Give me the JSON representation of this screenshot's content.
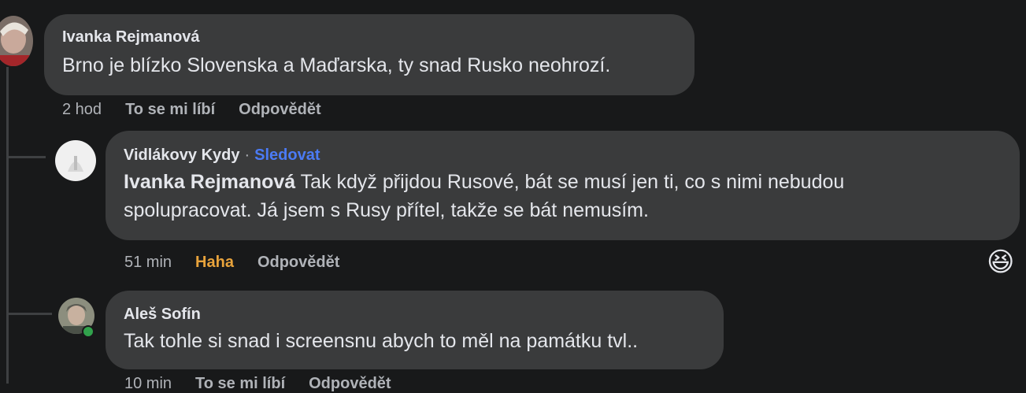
{
  "comments": [
    {
      "author": "Ivanka Rejmanová",
      "text": "Brno je blízko Slovenska a Maďarska, ty snad Rusko neohrozí.",
      "time": "2 hod",
      "like": "To se mi líbí",
      "reply": "Odpovědět"
    },
    {
      "author": "Vidlákovy Kydy",
      "follow": "Sledovat",
      "mention": "Ivanka Rejmanová",
      "text_line1": " Tak když přijdou Rusové, bát se musí jen ti, co s nimi nebudou",
      "text_line2": "spolupracovat. Já jsem s Rusy přítel, takže se bát nemusím.",
      "time": "51 min",
      "reaction_label": "Haha",
      "reply": "Odpovědět",
      "reaction_emoji": "😆"
    },
    {
      "author": "Aleš Sofín",
      "text": "Tak tohle si snad i screensnu abych to měl na památku tvl..",
      "time": "10 min",
      "like": "To se mi líbí",
      "reply": "Odpovědět"
    }
  ],
  "colors": {
    "background": "#18191a",
    "bubble": "#3a3b3c",
    "follow_link": "#4b7bf5",
    "haha": "#e8a33c",
    "online": "#31a24c"
  }
}
